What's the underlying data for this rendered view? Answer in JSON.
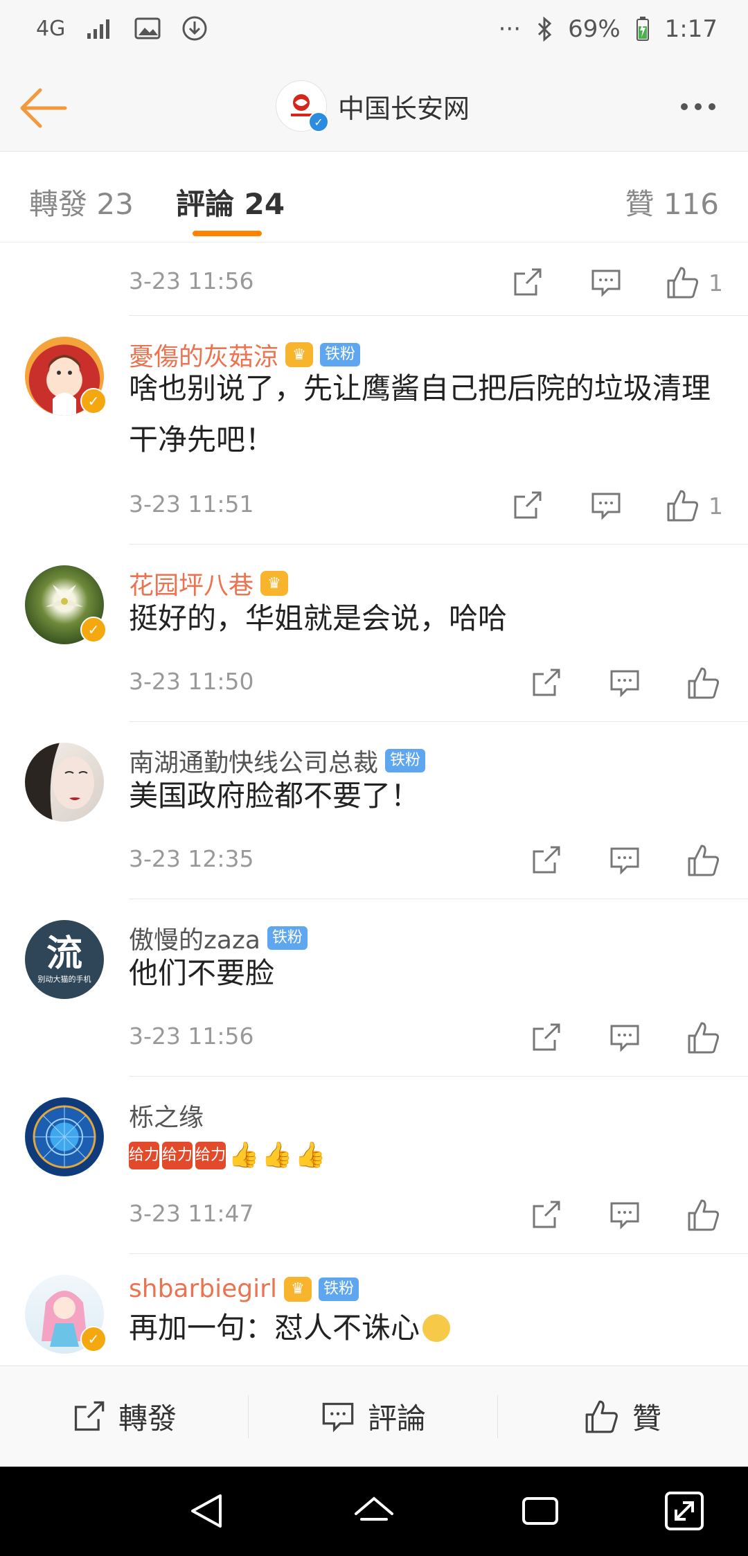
{
  "status_bar": {
    "network": "4G",
    "more": "···",
    "battery": "69%",
    "time": "1:17"
  },
  "header": {
    "title": "中国长安网",
    "back_icon": "arrow-left-icon",
    "more_icon": "more-dots-icon",
    "accent_color": "#f09a3b"
  },
  "tabs": [
    {
      "label": "轉發 23",
      "active": false
    },
    {
      "label": "評論 24",
      "active": true
    },
    {
      "label": "贊 116",
      "active": false
    }
  ],
  "comments": [
    {
      "name": "",
      "text": "",
      "time": "3-23 11:56",
      "likes": "1"
    },
    {
      "name": "憂傷的灰菇涼",
      "name_style": "vip",
      "crown_level": "6",
      "badge": "铁粉",
      "verified": true,
      "text": "啥也别说了，先让鹰酱自己把后院的垃圾清理干净先吧！",
      "time": "3-23 11:51",
      "likes": "1"
    },
    {
      "name": "花园坪八巷",
      "name_style": "vip",
      "crown_level": "6",
      "badge": "",
      "verified": true,
      "text": "挺好的，华姐就是会说，哈哈",
      "time": "3-23 11:50",
      "likes": ""
    },
    {
      "name": "南湖通勤快线公司总裁",
      "name_style": "normal",
      "badge": "铁粉",
      "verified": false,
      "text": "美国政府脸都不要了！",
      "time": "3-23 12:35",
      "likes": ""
    },
    {
      "name": "傲慢的zaza",
      "name_style": "normal",
      "badge": "铁粉",
      "verified": false,
      "avatar_char": "流",
      "avatar_subtext": "别动大猫的手机",
      "text": "他们不要脸",
      "time": "3-23 11:56",
      "likes": ""
    },
    {
      "name": "栎之缘",
      "name_style": "normal",
      "badge": "",
      "verified": false,
      "text": "",
      "emoji_text": "给力",
      "time": "3-23 11:47",
      "likes": ""
    },
    {
      "name": "shbarbiegirl",
      "name_style": "vip",
      "crown_level": "5",
      "badge": "铁粉",
      "verified": true,
      "text": "再加一句：怼人不诛心",
      "time": "",
      "likes": ""
    }
  ],
  "bottom_bar": {
    "repost": "轉發",
    "comment": "評論",
    "like": "贊"
  }
}
